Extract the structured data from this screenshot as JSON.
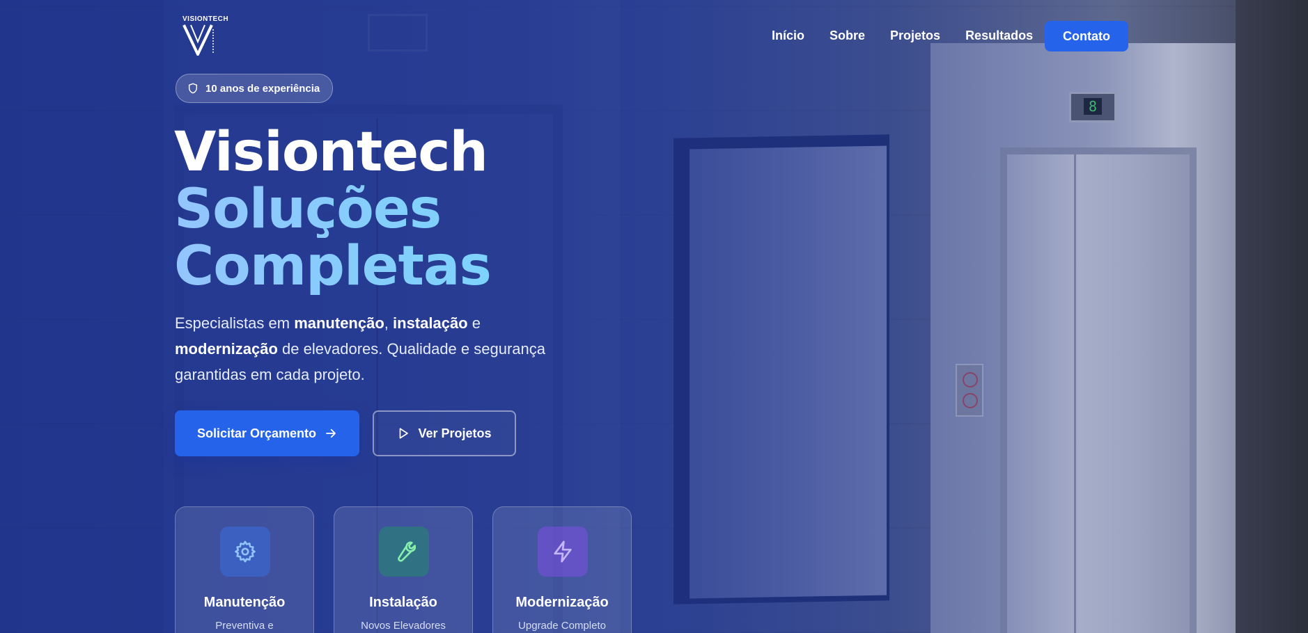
{
  "brand": {
    "logo_text": "VISIONTECH"
  },
  "nav": {
    "items": [
      {
        "label": "Início"
      },
      {
        "label": "Sobre"
      },
      {
        "label": "Projetos"
      },
      {
        "label": "Resultados"
      }
    ],
    "contact_label": "Contato"
  },
  "badge": {
    "icon": "shield-icon",
    "text": "10 anos de experiência"
  },
  "headline": {
    "line1": "Visiontech",
    "line2": "Soluções",
    "line3": "Completas"
  },
  "lead": {
    "p1": "Especialistas em ",
    "b1": "manutenção",
    "p2": ", ",
    "b2": "instalação",
    "p3": " e ",
    "b3": "modernização",
    "p4": " de elevadores. Qualidade e segurança garantidas em cada projeto."
  },
  "cta": {
    "primary": {
      "label": "Solicitar Orçamento",
      "icon": "arrow-right-icon"
    },
    "secondary": {
      "label": "Ver Projetos",
      "icon": "play-icon"
    }
  },
  "services": [
    {
      "title": "Manutenção",
      "subtitle": "Preventiva e",
      "icon": "gear-icon",
      "color": "#93c5fd"
    },
    {
      "title": "Instalação",
      "subtitle": "Novos Elevadores",
      "icon": "wrench-icon",
      "color": "#86efac"
    },
    {
      "title": "Modernização",
      "subtitle": "Upgrade Completo",
      "icon": "bolt-icon",
      "color": "#c4b5fd"
    }
  ],
  "scene": {
    "floor_indicator": "8"
  },
  "colors": {
    "primary": "#2563eb",
    "accent_gradient_start": "#93c5fd",
    "accent_gradient_end": "#7dd3fc"
  }
}
